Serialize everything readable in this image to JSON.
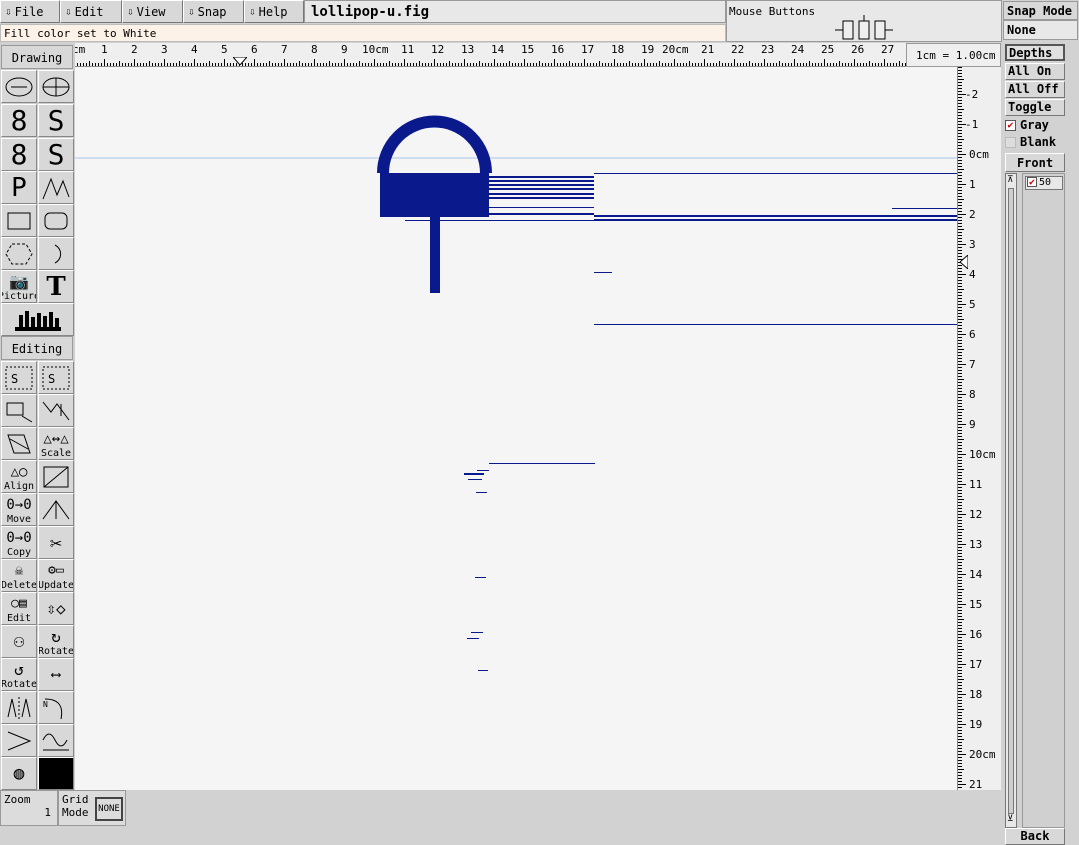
{
  "menu": [
    {
      "label": "File",
      "name": "file-menu"
    },
    {
      "label": "Edit",
      "name": "edit-menu"
    },
    {
      "label": "View",
      "name": "view-menu"
    },
    {
      "label": "Snap",
      "name": "snap-menu"
    },
    {
      "label": "Help",
      "name": "help-menu"
    }
  ],
  "filename": "lollipop-u.fig",
  "mouse_buttons_title": "Mouse Buttons",
  "message": "Fill color set to White",
  "ruler_scale": "1cm = 1.00cm",
  "hruler_labels": [
    "cm",
    "1",
    "2",
    "3",
    "4",
    "5",
    "6",
    "7",
    "8",
    "9",
    "10cm",
    "11",
    "12",
    "13",
    "14",
    "15",
    "16",
    "17",
    "18",
    "19",
    "20cm",
    "21",
    "22",
    "23",
    "24",
    "25",
    "26",
    "27"
  ],
  "vruler_labels": [
    "-2",
    "-1",
    "0cm",
    "1",
    "2",
    "3",
    "4",
    "5",
    "6",
    "7",
    "8",
    "9",
    "10cm",
    "11",
    "12",
    "13",
    "14",
    "15",
    "16",
    "17",
    "18",
    "19",
    "20cm",
    "21"
  ],
  "sections": {
    "drawing": "Drawing",
    "editing": "Editing"
  },
  "tool_labels": {
    "picture": "Picture",
    "text": "T",
    "scale": "Scale",
    "align": "Align",
    "move": "Move",
    "copy": "Copy",
    "delete": "Delete",
    "update": "Update",
    "edit": "Edit",
    "rotate_cw": "Rotate",
    "rotate_ccw": "Rotate"
  },
  "zoom": {
    "label": "Zoom",
    "value": "1"
  },
  "grid": {
    "label1": "Grid",
    "label2": "Mode",
    "value": "NONE"
  },
  "snap": {
    "title": "Snap Mode",
    "value": "None"
  },
  "depths": {
    "title": "Depths",
    "all_on": "All On",
    "all_off": "All Off",
    "toggle": "Toggle",
    "gray": "Gray",
    "blank": "Blank",
    "front": "Front",
    "back": "Back",
    "depth_value": "50"
  },
  "colors": {
    "ink": "#0a1a8c",
    "canvas": "#f5f5f5"
  }
}
